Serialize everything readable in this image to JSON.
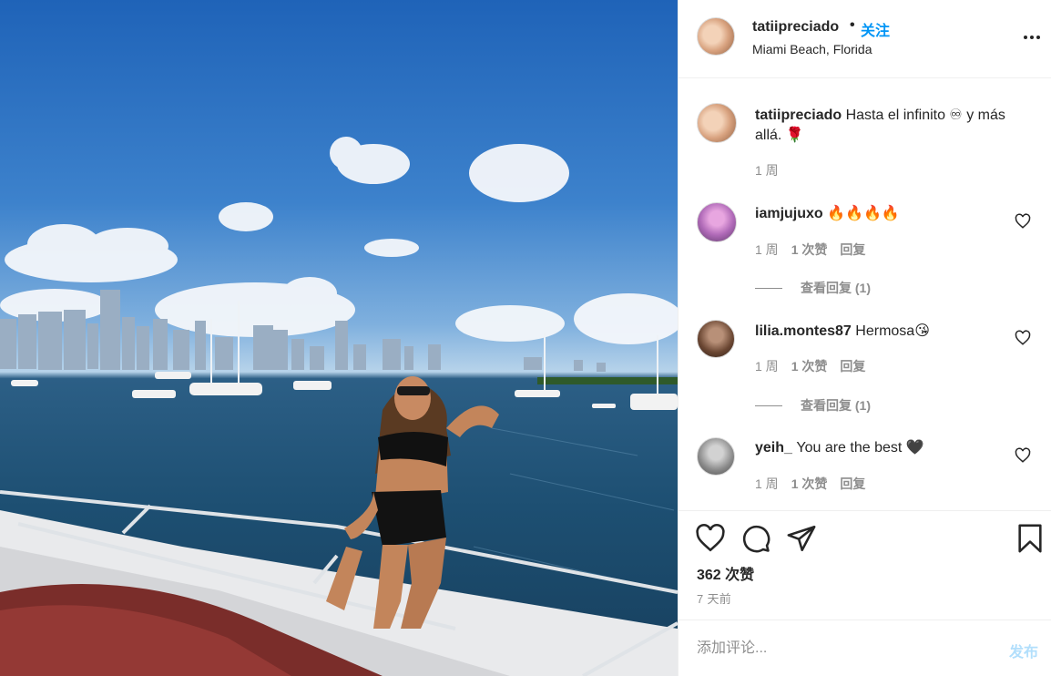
{
  "post": {
    "username": "tatiipreciado",
    "separator": "•",
    "follow_label": "关注",
    "location": "Miami Beach, Florida",
    "image_alt": "Woman in black bikini on a yacht with Miami skyline"
  },
  "caption": {
    "username": "tatiipreciado",
    "text": "Hasta el infinito ♾ y más allá. 🌹",
    "time": "1 周"
  },
  "comments": [
    {
      "username": "iamjujuxo",
      "text": "🔥🔥🔥🔥",
      "time": "1 周",
      "likes": "1 次赞",
      "reply_label": "回复",
      "view_replies": "查看回复 (1)"
    },
    {
      "username": "lilia.montes87",
      "text": "Hermosa😘",
      "time": "1 周",
      "likes": "1 次赞",
      "reply_label": "回复",
      "view_replies": "查看回复 (1)"
    },
    {
      "username": "yeih_",
      "text": "You are the best 🖤",
      "time": "1 周",
      "likes": "1 次赞",
      "reply_label": "回复"
    }
  ],
  "stats": {
    "likes": "362 次赞",
    "posted": "7 天前"
  },
  "add_comment": {
    "placeholder": "添加评论...",
    "post_label": "发布"
  },
  "icons": [
    "more-icon",
    "heart-icon",
    "comment-icon",
    "share-icon",
    "bookmark-icon"
  ],
  "colors": {
    "link": "#0095f6",
    "muted": "#8e8e8e",
    "text": "#262626",
    "post_disabled": "#b2dffc"
  }
}
